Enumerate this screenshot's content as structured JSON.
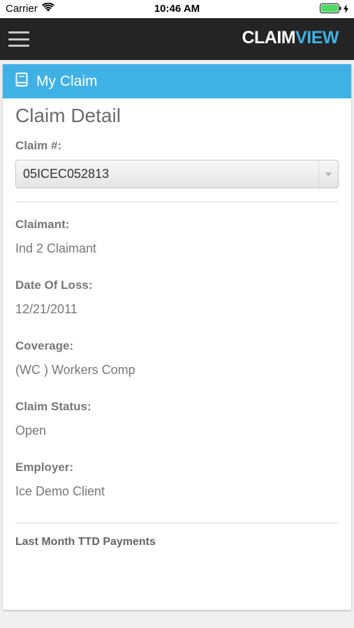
{
  "status_bar": {
    "carrier": "Carrier",
    "time": "10:46 AM"
  },
  "header": {
    "logo_part1": "CLAIM",
    "logo_part2": "VIEW"
  },
  "card": {
    "title": "My Claim",
    "page_title": "Claim Detail",
    "claim_label": "Claim #:",
    "claim_selected": "05ICEC052813",
    "fields": [
      {
        "label": "Claimant:",
        "value": "Ind 2 Claimant"
      },
      {
        "label": "Date Of Loss:",
        "value": "12/21/2011"
      },
      {
        "label": "Coverage:",
        "value": "(WC ) Workers Comp"
      },
      {
        "label": "Claim Status:",
        "value": "Open"
      },
      {
        "label": "Employer:",
        "value": "Ice Demo Client"
      }
    ],
    "section_title": "Last Month TTD Payments"
  },
  "colors": {
    "accent": "#3fb1e5",
    "header_bg": "#242424"
  },
  "icons": {
    "menu": "hamburger-menu-icon",
    "card_header": "book-icon",
    "wifi": "wifi-icon",
    "battery": "battery-icon",
    "charging": "charging-bolt-icon",
    "dropdown": "dropdown-arrow-icon"
  }
}
